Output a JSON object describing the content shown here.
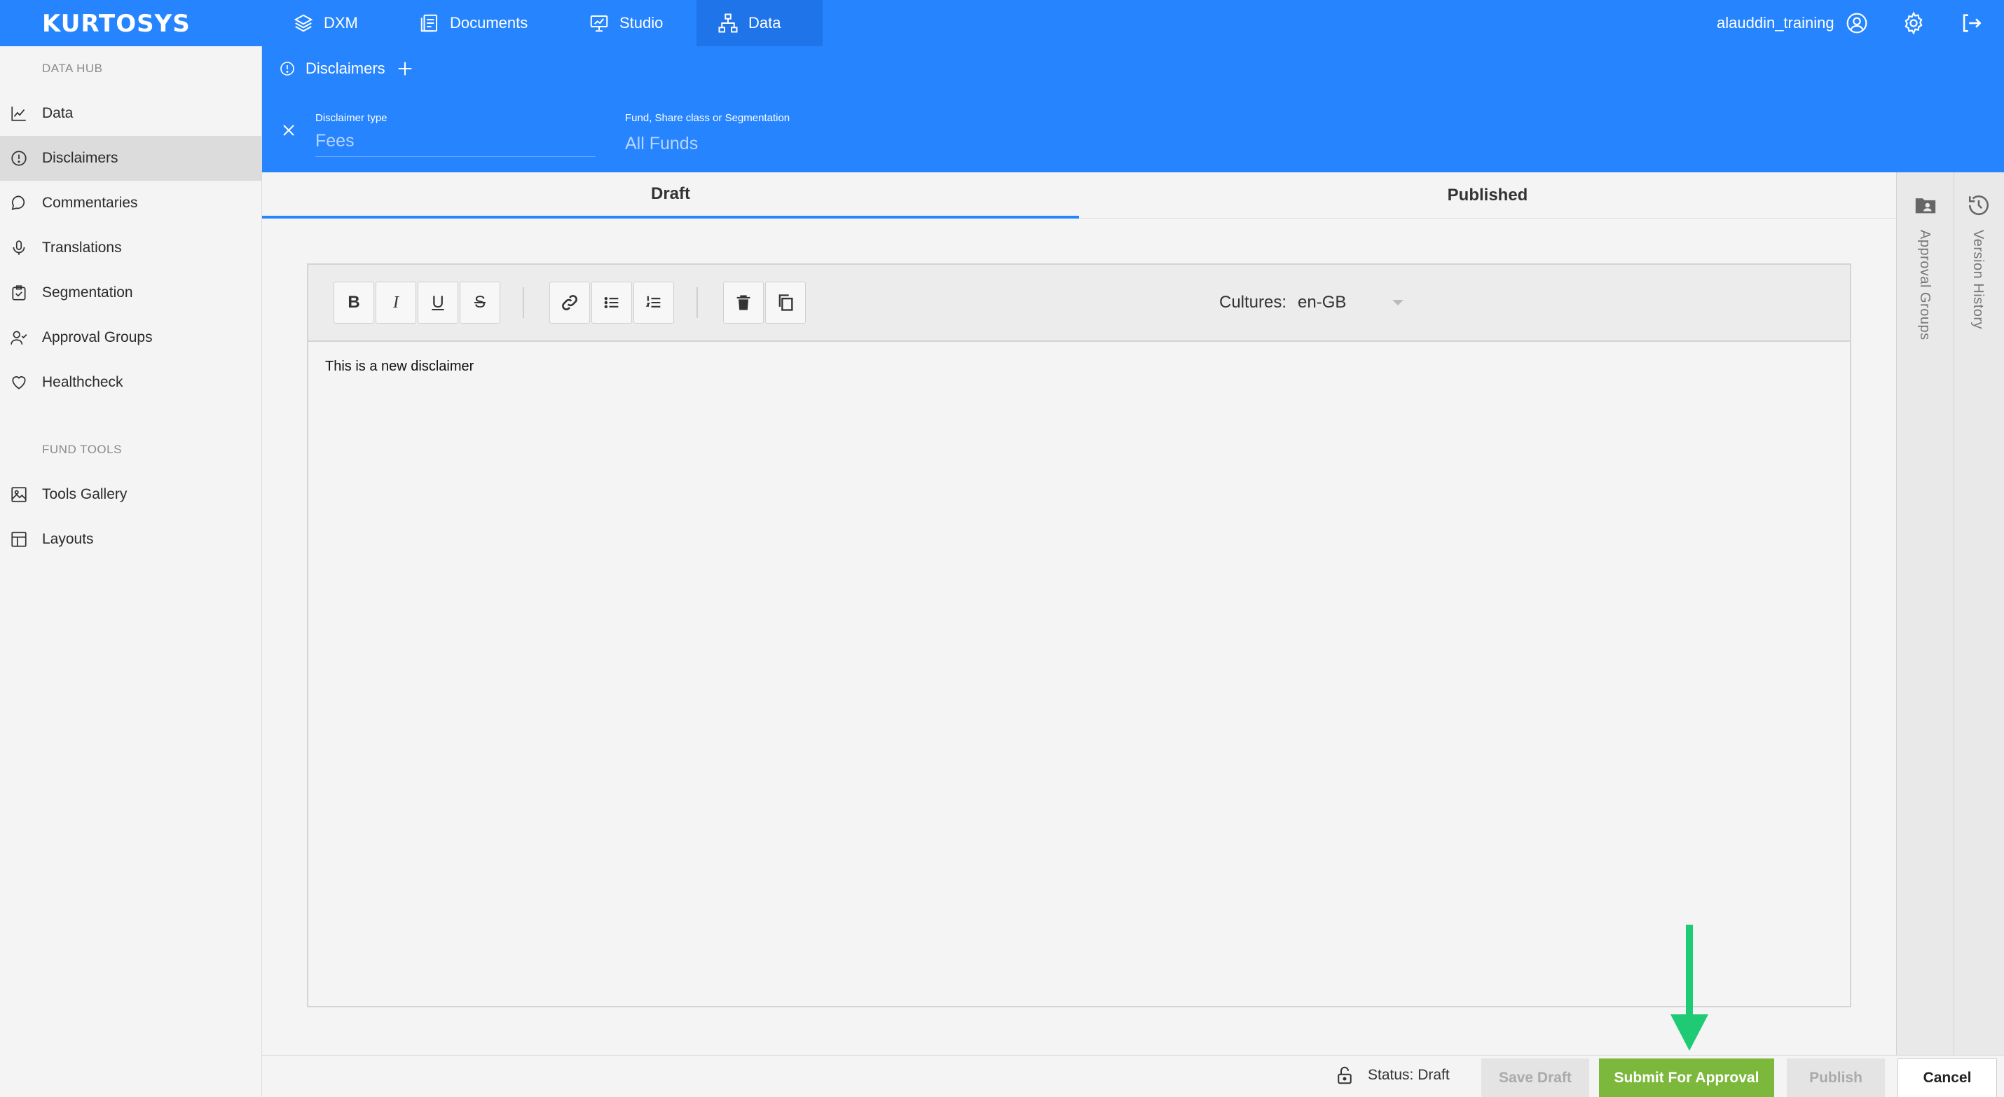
{
  "topbar": {
    "logo": "KURTOSYS",
    "nav": [
      {
        "label": "DXM",
        "icon": "layers-icon"
      },
      {
        "label": "Documents",
        "icon": "documents-icon"
      },
      {
        "label": "Studio",
        "icon": "presentation-icon"
      },
      {
        "label": "Data",
        "icon": "hierarchy-icon",
        "active": true
      }
    ],
    "user": "alauddin_training"
  },
  "sidebar": {
    "heading_data_hub": "DATA HUB",
    "items": [
      {
        "label": "Data",
        "icon": "chart-line-icon"
      },
      {
        "label": "Disclaimers",
        "icon": "alert-circle-icon",
        "active": true
      },
      {
        "label": "Commentaries",
        "icon": "chat-bubble-icon"
      },
      {
        "label": "Translations",
        "icon": "microphone-icon"
      },
      {
        "label": "Segmentation",
        "icon": "clipboard-icon"
      },
      {
        "label": "Approval Groups",
        "icon": "user-check-icon"
      },
      {
        "label": "Healthcheck",
        "icon": "heart-icon"
      }
    ],
    "heading_fund_tools": "FUND TOOLS",
    "tools": [
      {
        "label": "Tools Gallery",
        "icon": "image-icon"
      },
      {
        "label": "Layouts",
        "icon": "layout-icon"
      }
    ]
  },
  "subbar": {
    "crumb": "Disclaimers",
    "filters": {
      "disclaimer_type_label": "Disclaimer type",
      "disclaimer_type_value": "Fees",
      "fund_label": "Fund, Share class or Segmentation",
      "fund_value": "All Funds"
    }
  },
  "tabs": {
    "draft": "Draft",
    "published": "Published"
  },
  "rails": {
    "approval_groups": "Approval Groups",
    "version_history": "Version History"
  },
  "editor": {
    "toolbar": {
      "bold": "B",
      "italic": "I",
      "underline": "U",
      "strike": "S"
    },
    "cultures_label": "Cultures:",
    "cultures_value": "en-GB",
    "content": "This is a new disclaimer"
  },
  "footer": {
    "status": "Status: Draft",
    "save_draft": "Save Draft",
    "submit": "Submit For Approval",
    "publish": "Publish",
    "cancel": "Cancel"
  },
  "colors": {
    "brand": "#2684ff",
    "submit": "#7cb83c",
    "annotation_arrow": "#1fca74"
  }
}
